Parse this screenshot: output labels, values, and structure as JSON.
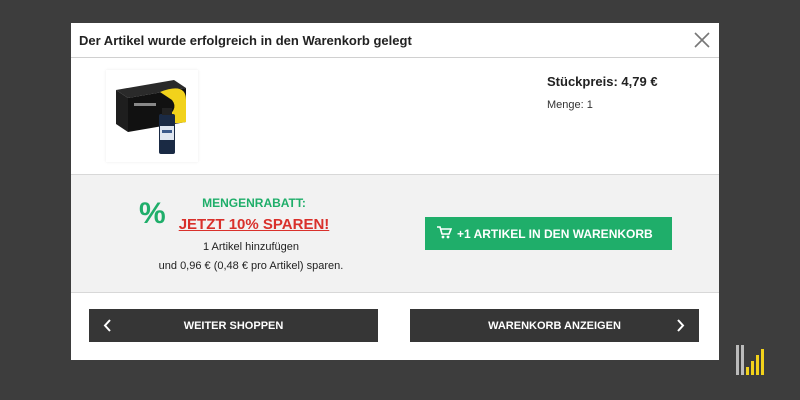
{
  "modal": {
    "title": "Der Artikel wurde erfolgreich in den Warenkorb gelegt",
    "close_icon": "close-icon"
  },
  "product": {
    "image_alt": "Toner cartridge with ink bottle",
    "price_label": "Stückpreis: 4,79 €",
    "qty_label": "Menge: 1"
  },
  "discount": {
    "icon": "percent-icon",
    "icon_glyph": "%",
    "heading": "MENGENRABATT:",
    "save_text": "JETZT 10% SPAREN!",
    "line1": "1 Artikel hinzufügen",
    "line2": "und 0,96 € (0,48 € pro Artikel) sparen.",
    "add_button_label": "+1 ARTIKEL IN DEN WARENKORB",
    "add_button_icon": "cart-icon"
  },
  "actions": {
    "continue_label": "WEITER SHOPPEN",
    "cart_label": "WARENKORB ANZEIGEN"
  },
  "colors": {
    "accent_green": "#1fae6a",
    "accent_red": "#d9302b",
    "dark_button": "#363636",
    "backdrop": "#3d3d3d",
    "logo_yellow": "#f2d21b"
  }
}
